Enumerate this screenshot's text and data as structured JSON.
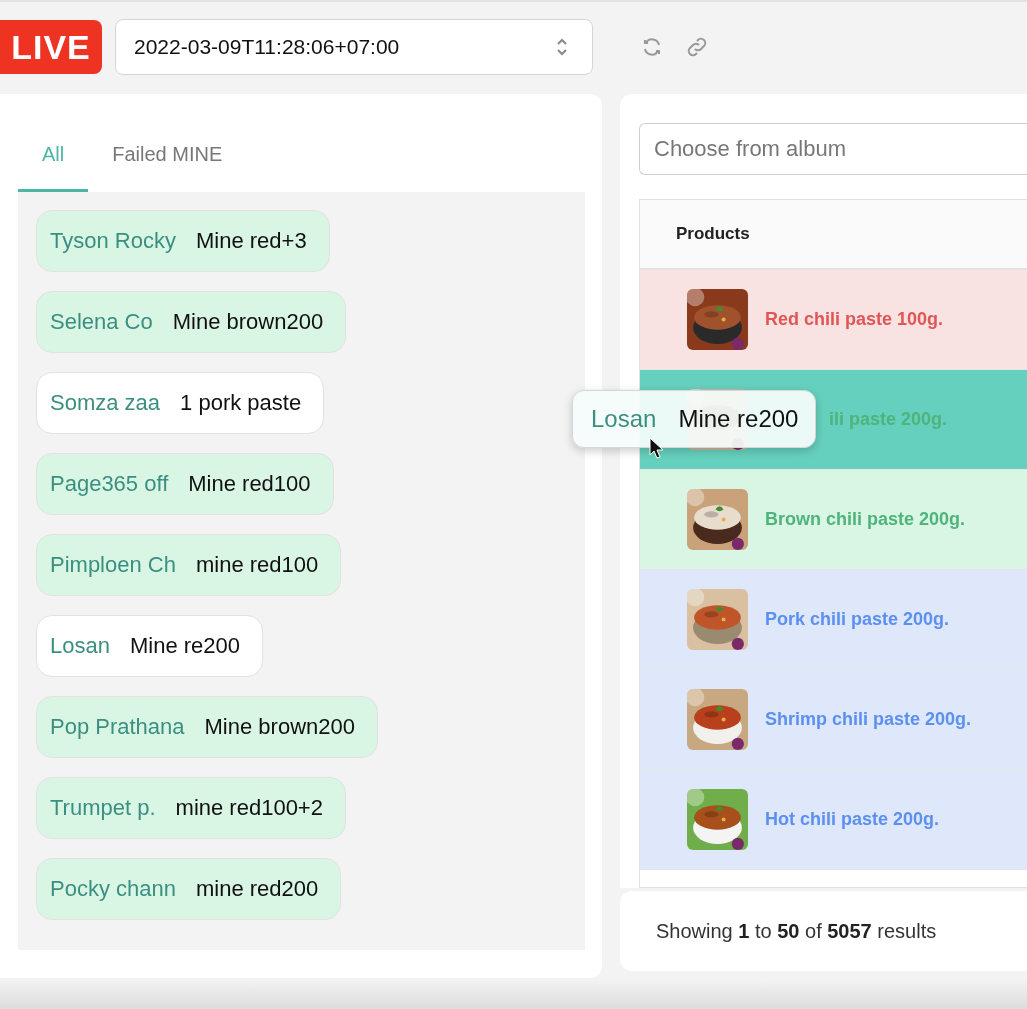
{
  "live_badge": "LIVE",
  "timestamp_select": {
    "value": "2022-03-09T11:28:06+07:00"
  },
  "tabs": [
    {
      "label": "All",
      "selected": true
    },
    {
      "label": "Failed MINE",
      "selected": false
    }
  ],
  "comments": [
    {
      "name": "Tyson Rocky",
      "text": "Mine red+3",
      "matched": true
    },
    {
      "name": "Selena Co",
      "text": "Mine brown200",
      "matched": true
    },
    {
      "name": "Somza zaa",
      "text": "1 pork paste",
      "matched": false
    },
    {
      "name": "Page365 off",
      "text": "Mine red100",
      "matched": true
    },
    {
      "name": "Pimploen Ch",
      "text": "mine red100",
      "matched": true
    },
    {
      "name": "Losan",
      "text": "Mine re200",
      "matched": false
    },
    {
      "name": "Pop Prathana",
      "text": "Mine brown200",
      "matched": true
    },
    {
      "name": "Trumpet p.",
      "text": "mine red100+2",
      "matched": true
    },
    {
      "name": "Pocky chann",
      "text": "mine red200",
      "matched": true
    }
  ],
  "dragged_comment": {
    "name": "Losan",
    "text": "Mine re200"
  },
  "album_field": {
    "placeholder": "Choose from album"
  },
  "products": {
    "columns": [
      "Products"
    ],
    "rows": [
      {
        "name": "Red chili paste 100g.",
        "color": "#e05656",
        "drop_target": false
      },
      {
        "name": "ili paste 200g.",
        "color": "#4fb37c",
        "drop_target": true
      },
      {
        "name": "Brown chili paste 200g.",
        "color": "#4fb37c",
        "drop_target": false
      },
      {
        "name": "Pork chili paste 200g.",
        "color": "#5b8ff0",
        "drop_target": false
      },
      {
        "name": "Shrimp chili paste 200g.",
        "color": "#5b8ff0",
        "drop_target": false
      },
      {
        "name": "Hot chili paste 200g.",
        "color": "#5b8ff0",
        "drop_target": false
      }
    ]
  },
  "pagination": "Showing **1** to **50** of **5057** results"
}
